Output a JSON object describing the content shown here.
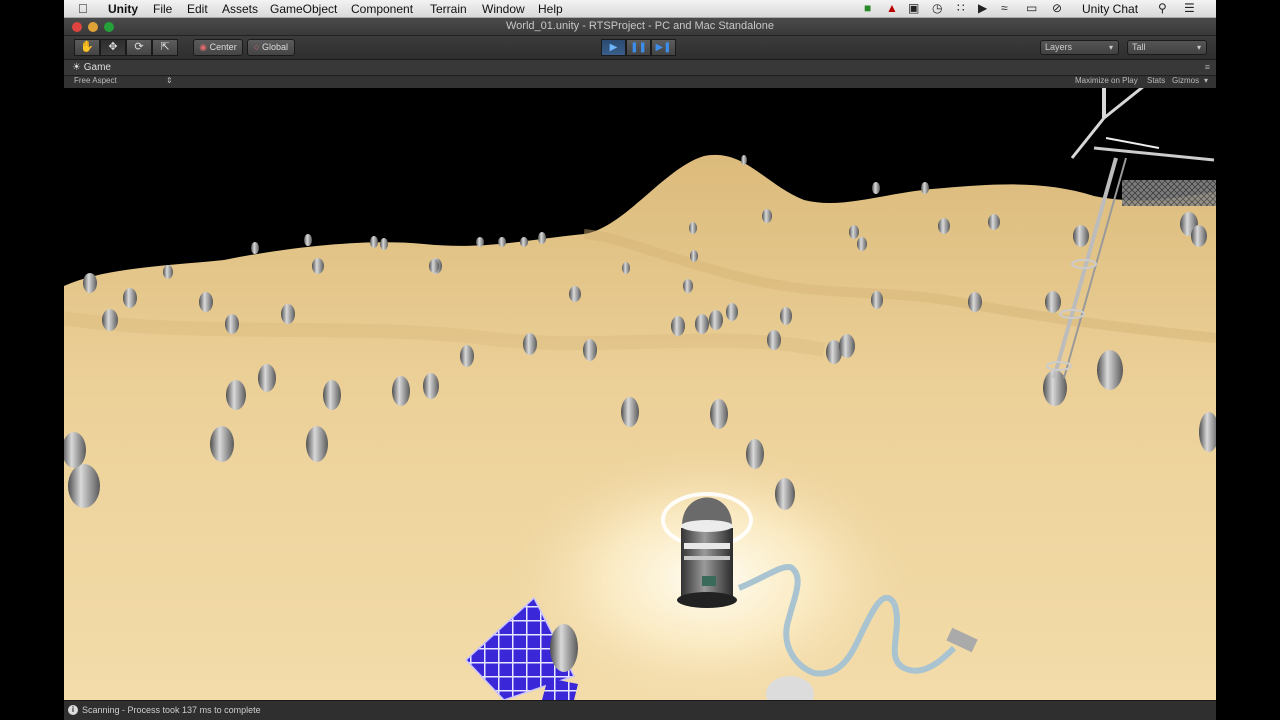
{
  "menubar": {
    "app_name": "Unity",
    "items": [
      "File",
      "Edit",
      "Assets",
      "GameObject",
      "Component",
      "Terrain",
      "Window",
      "Help"
    ],
    "right_label": "Unity Chat"
  },
  "window": {
    "title": "World_01.unity - RTSProject - PC and Mac Standalone"
  },
  "toolbar": {
    "pivot_label": "Center",
    "space_label": "Global",
    "layers_label": "Layers",
    "layout_label": "Tall"
  },
  "game_view": {
    "tab_label": "Game",
    "aspect_label": "Free Aspect",
    "maximize_label": "Maximize on Play",
    "stats_label": "Stats",
    "gizmos_label": "Gizmos"
  },
  "status": {
    "message": "Scanning - Process took 137 ms to complete"
  },
  "icons": {
    "apple": "apple-icon",
    "hand": "hand-tool-icon",
    "move": "move-tool-icon",
    "rotate": "rotate-tool-icon",
    "scale": "scale-tool-icon",
    "play": "play-icon",
    "pause": "pause-icon",
    "step": "step-icon"
  },
  "colors": {
    "sand": "#e8c98d",
    "sky": "#000000",
    "accent_play": "#3b8de8",
    "solar_panel": "#3a2ad0"
  }
}
